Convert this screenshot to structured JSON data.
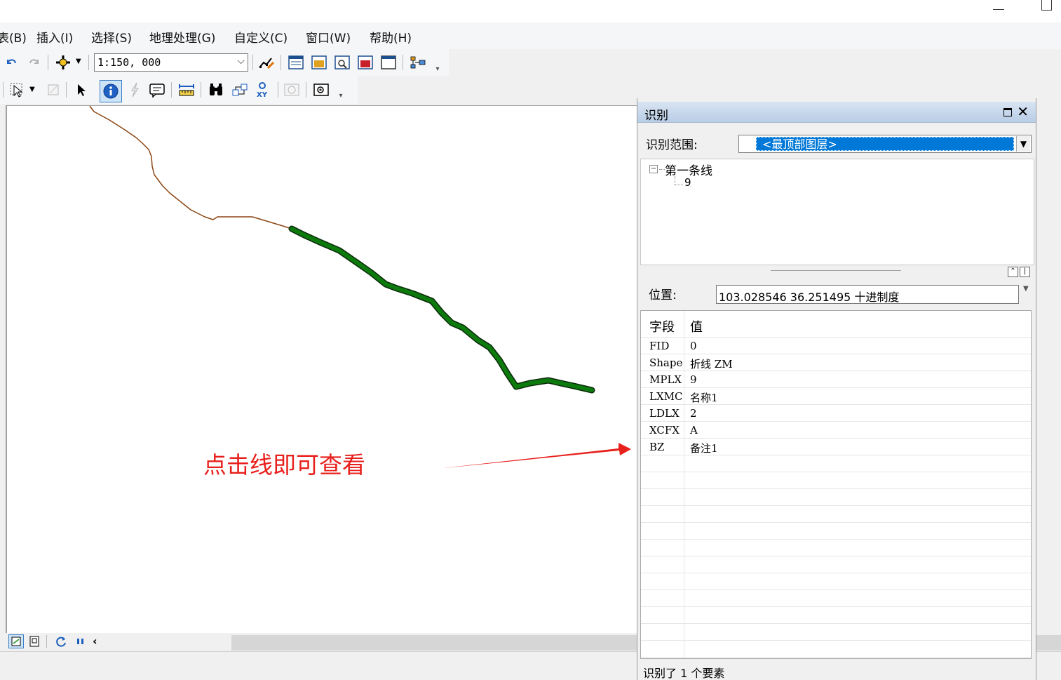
{
  "menu": {
    "items": [
      "表(B)",
      "插入(I)",
      "选择(S)",
      "地理处理(G)",
      "自定义(C)",
      "窗口(W)",
      "帮助(H)"
    ]
  },
  "toolbar": {
    "scale_value": "1:150, 000",
    "icons1": [
      "undo-icon",
      "redo-icon",
      "add-data-icon",
      "editor-icon",
      "table-of-contents-icon",
      "catalog-icon",
      "search-window-icon",
      "arctoolbox-icon",
      "python-icon",
      "model-builder-icon"
    ],
    "icons2": [
      "select-elements-icon",
      "clear-selection-icon",
      "select-arrow-icon",
      "identify-icon",
      "hyperlink-icon",
      "html-popup-icon",
      "measure-icon",
      "find-icon",
      "find-route-icon",
      "go-to-xy-icon",
      "time-slider-icon",
      "create-viewer-window-icon"
    ]
  },
  "map": {
    "annotation": "点击线即可查看",
    "colors": {
      "thin_line": "#8b4513",
      "selected_line": "#0d7a0d",
      "arrow": "#e8201c"
    }
  },
  "identify": {
    "title": "识别",
    "scope_label": "识别范围:",
    "scope_value": "<最顶部图层>",
    "tree_layer": "第一条线",
    "tree_feature": "9",
    "location_label": "位置:",
    "location_value": "103.028546   36.251495 十进制度",
    "field_header": "字段",
    "value_header": "值",
    "rows": [
      {
        "field": "FID",
        "value": "0"
      },
      {
        "field": "Shape",
        "value": "折线 ZM"
      },
      {
        "field": "MPLX",
        "value": "9"
      },
      {
        "field": "LXMC",
        "value": "名称1"
      },
      {
        "field": "LDLX",
        "value": "2"
      },
      {
        "field": "XCFX",
        "value": "A"
      },
      {
        "field": "BZ",
        "value": "备注1"
      }
    ],
    "status": "识别了 1 个要素"
  }
}
